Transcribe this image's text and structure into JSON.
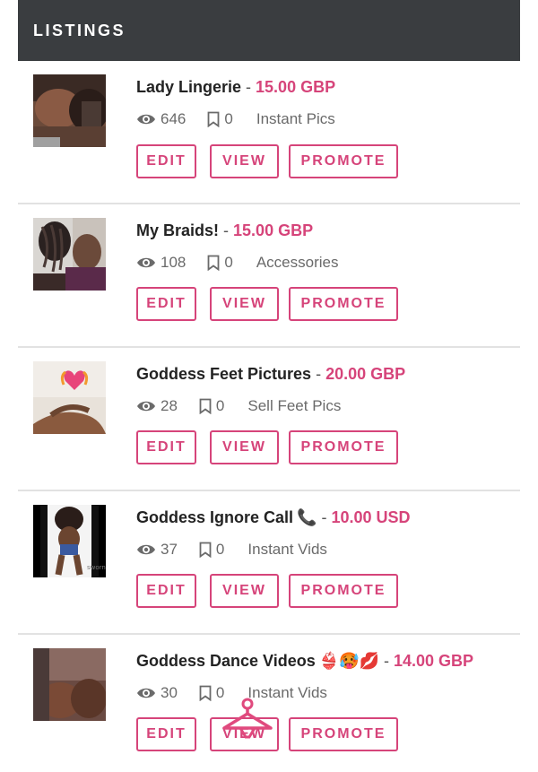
{
  "header": {
    "title": "LISTINGS"
  },
  "listings": [
    {
      "title": "Lady Lingerie",
      "emoji": "",
      "price": "15.00 GBP",
      "views": "646",
      "saves": "0",
      "category": "Instant Pics"
    },
    {
      "title": "My Braids!",
      "emoji": "",
      "price": "15.00 GBP",
      "views": "108",
      "saves": "0",
      "category": "Accessories"
    },
    {
      "title": "Goddess Feet Pictures",
      "emoji": "",
      "price": "20.00 GBP",
      "views": "28",
      "saves": "0",
      "category": "Sell Feet Pics"
    },
    {
      "title": "Goddess Ignore Call",
      "emoji": "📞",
      "price": "10.00 USD",
      "views": "37",
      "saves": "0",
      "category": "Instant Vids"
    },
    {
      "title": "Goddess Dance Videos",
      "emoji": "👙🥵💋",
      "price": "14.00 GBP",
      "views": "30",
      "saves": "0",
      "category": "Instant Vids"
    }
  ],
  "buttons": {
    "edit": "EDIT",
    "view": "VIEW",
    "promote": "PROMOTE"
  },
  "thumb_watermark": "sworn",
  "colors": {
    "accent": "#d6447a",
    "header_bg": "#3a3d40",
    "divider": "#e2e2e2"
  }
}
